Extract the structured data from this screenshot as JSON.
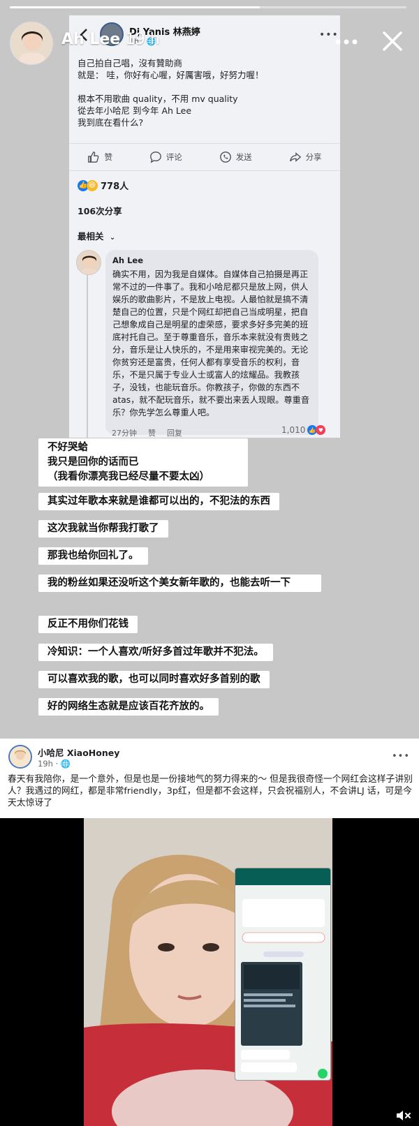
{
  "story": {
    "progress": 0.63,
    "user": "Ah Lee",
    "time": "19 h",
    "more_icon": "more-horizontal-icon",
    "close_icon": "close-icon"
  },
  "screenshot": {
    "author": "Dj Yanis 林燕婷",
    "meta": "1h · 🌐",
    "post_text": "自己拍自己唱，沒有贊助商\n就是： 哇，你好有心喔，好厲害哦，好努力喔！\n\n根本不用歌曲 quality，不用 mv quality\n從去年小哈尼 到今年 Ah Lee\n我到底在看什么?",
    "actions": [
      {
        "label": "赞",
        "icon": "thumbs-up-icon"
      },
      {
        "label": "评论",
        "icon": "comment-icon"
      },
      {
        "label": "发送",
        "icon": "whatsapp-icon"
      },
      {
        "label": "分享",
        "icon": "share-icon"
      }
    ],
    "reactions_count": "778人",
    "shares": "106次分享",
    "sort_label": "最相关",
    "comment": {
      "name": "Ah Lee",
      "text": "确实不用，因为我是自媒体。自媒体自己拍摄是再正常不过的一件事了。我和小哈尼都只是放上网，供人娱乐的歌曲影片，不是放上电视。人最怕就是搞不清楚自己的位置，只是个网红却把自己当成明星，把自己想象成自己是明星的虚荣感，要求多好多完美的班底衬托自己。至于尊重音乐，音乐本来就没有贵贱之分，音乐是让人快乐的，不是用来审视完美的。无论你贫穷还是富贵，任何人都有享受音乐的权利，音乐，不是只属于专业人士或富人的炫耀品。我教孩子，没钱，也能玩音乐。你教孩子，你做的东西不atas，就不配玩音乐，就不要出来丢人现眼。尊重音乐？你先学怎么尊重人吧。",
      "time": "27分钟",
      "like": "赞",
      "reply": "回复",
      "likes": "1,010"
    }
  },
  "overlays": [
    "不好哭蛤\n我只是回你的话而已\n（我看你漂亮我已经尽量不要太凶）",
    "其实过年歌本来就是谁都可以出的，不犯法的东西",
    "这次我就当你帮我打歌了",
    "那我也给你回礼了。",
    "我的粉丝如果还没听这个美女新年歌的，也能去听一下",
    "反正不用你们花钱",
    "冷知识：一个人喜欢/听好多首过年歌并不犯法。",
    "可以喜欢我的歌，也可以同时喜欢好多首别的歌",
    "好的网络生态就是应该百花齐放的。"
  ],
  "post": {
    "author": "小哈尼 XiaoHoney",
    "meta": "19h · 🌐",
    "text": "春天有我陪你，是一个意外，但是也是一份接地气的努力得来的～ 但是我很奇怪一个网红会这样子讲别人？我遇过的网红，都是非常friendly，3p红，但是都不会这样，只会祝福别人，不会讲LJ 话，可是今天太惊讶了"
  },
  "colors": {
    "accent": "#1877f2",
    "whatsapp": "#075e54",
    "background": "#c7c7c7"
  }
}
